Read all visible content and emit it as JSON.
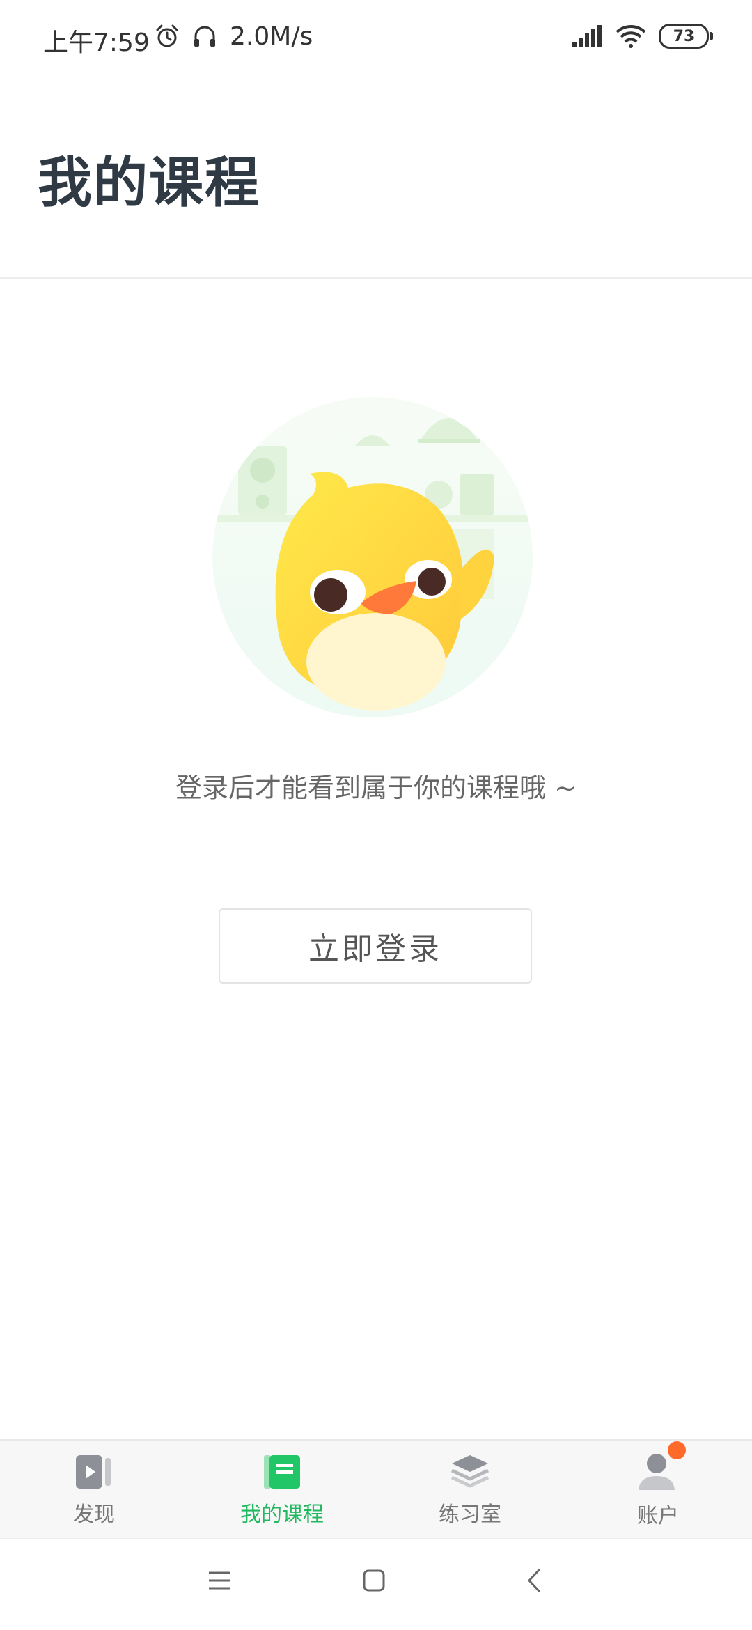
{
  "status_bar": {
    "time": "上午7:59",
    "speed": "2.0M/s",
    "battery": "73"
  },
  "header": {
    "title": "我的课程"
  },
  "empty_state": {
    "message": "登录后才能看到属于你的课程哦 ~",
    "login_button": "立即登录"
  },
  "bottom_nav": {
    "items": [
      {
        "label": "发现",
        "icon": "discover-icon",
        "active": false
      },
      {
        "label": "我的课程",
        "icon": "my-courses-icon",
        "active": true
      },
      {
        "label": "练习室",
        "icon": "practice-room-icon",
        "active": false
      },
      {
        "label": "账户",
        "icon": "account-icon",
        "active": false,
        "badge": true
      }
    ]
  },
  "colors": {
    "accent": "#21b860",
    "badge": "#ff6a2a",
    "title": "#2f3a44"
  }
}
